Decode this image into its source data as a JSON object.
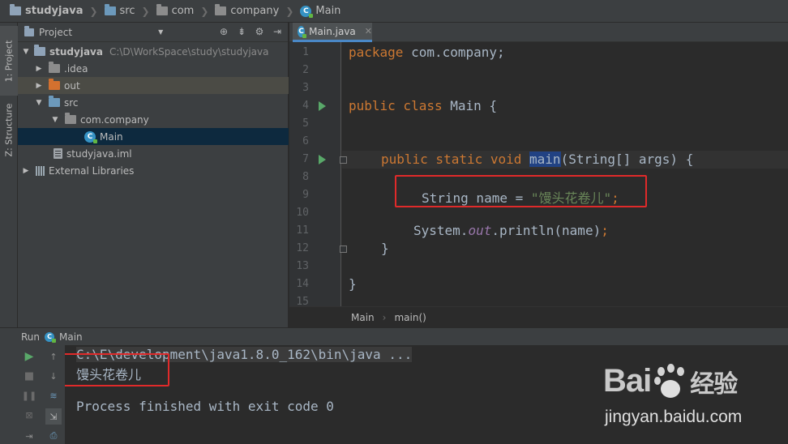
{
  "navbar": {
    "crumbs": [
      "studyjava",
      "src",
      "com",
      "company",
      "Main"
    ]
  },
  "left_strip": {
    "project_tab": "1: Project",
    "structure_tab": "Z: Structure"
  },
  "project_panel": {
    "title": "Project",
    "tree": [
      {
        "label": "studyjava",
        "path": "C:\\D\\WorkSpace\\study\\studyjava"
      },
      {
        "label": ".idea"
      },
      {
        "label": "out"
      },
      {
        "label": "src"
      },
      {
        "label": "com.company"
      },
      {
        "label": "Main"
      },
      {
        "label": "studyjava.iml"
      },
      {
        "label": "External Libraries"
      }
    ]
  },
  "editor": {
    "tab_label": "Main.java",
    "line_numbers": [
      "1",
      "2",
      "3",
      "4",
      "5",
      "6",
      "7",
      "8",
      "9",
      "10",
      "11",
      "12",
      "13",
      "14",
      "15"
    ],
    "code": {
      "l1_kw": "package",
      "l1_rest": " com.company;",
      "l4_kw": "public class",
      "l4_rest": " Main {",
      "l7_kw": "public static void",
      "l7_name": "main",
      "l7_rest": "(String[] args) {",
      "l9_a": "String name = ",
      "l9_str": "\"馒头花卷儿\"",
      "l9_semi": ";",
      "l11_a": "System.",
      "l11_out": "out",
      "l11_b": ".println(name)",
      "l11_semi": ";",
      "l12": "}",
      "l14": "}"
    },
    "breadcrumbs": [
      "Main",
      "main()"
    ]
  },
  "run_panel": {
    "label": "Run",
    "config": "Main",
    "console": {
      "command": "C:\\E\\development\\java1.8.0_162\\bin\\java ...",
      "output": "馒头花卷儿",
      "exit": "Process finished with exit code 0"
    }
  },
  "watermark": {
    "logo_left": "Bai",
    "logo_right": "经验",
    "url": "jingyan.baidu.com"
  },
  "colors": {
    "keyword": "#cc7832",
    "string": "#6a8759",
    "field": "#9876aa",
    "highlight_box": "#e02a2a",
    "run_icon": "#59a869"
  }
}
